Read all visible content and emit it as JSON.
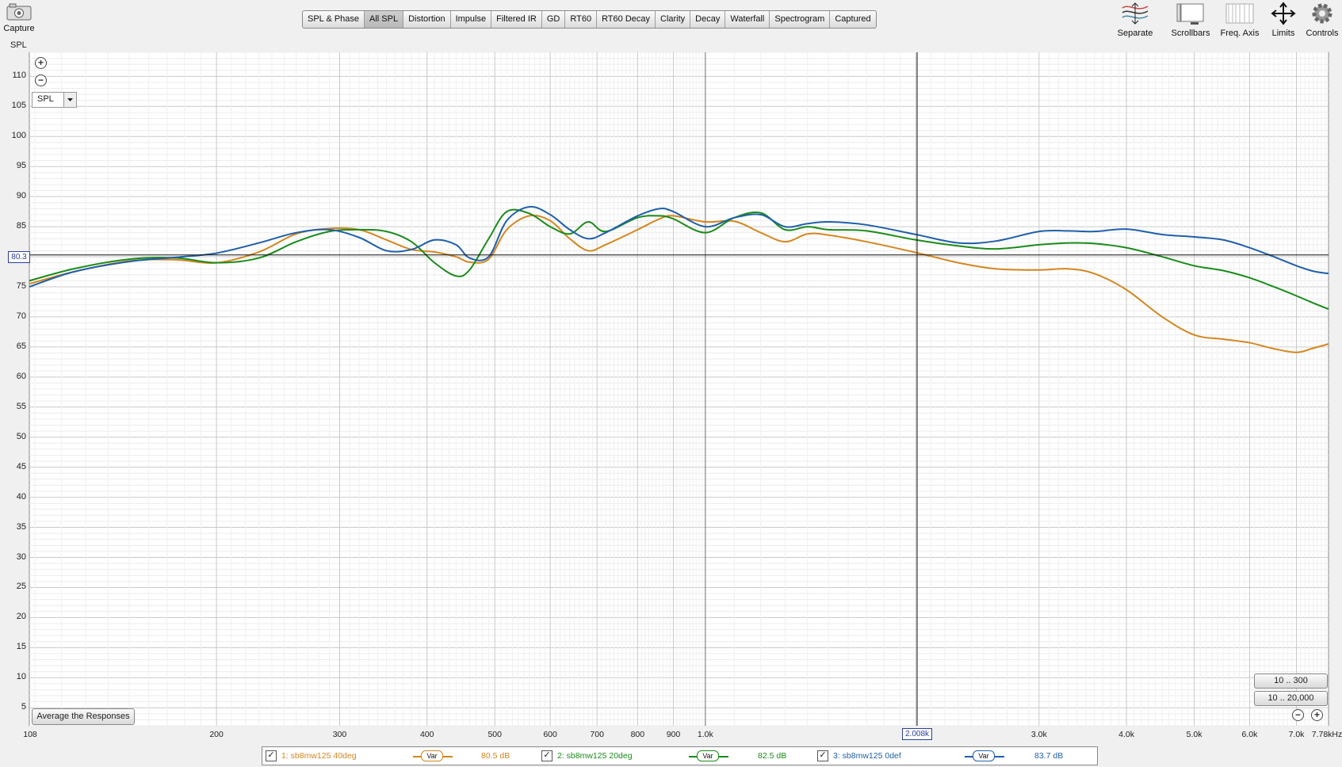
{
  "toolbar": {
    "capture_label": "Capture",
    "tabs": [
      {
        "label": "SPL & Phase",
        "active": false
      },
      {
        "label": "All SPL",
        "active": true
      },
      {
        "label": "Distortion",
        "active": false
      },
      {
        "label": "Impulse",
        "active": false
      },
      {
        "label": "Filtered IR",
        "active": false
      },
      {
        "label": "GD",
        "active": false
      },
      {
        "label": "RT60",
        "active": false
      },
      {
        "label": "RT60 Decay",
        "active": false
      },
      {
        "label": "Clarity",
        "active": false
      },
      {
        "label": "Decay",
        "active": false
      },
      {
        "label": "Waterfall",
        "active": false
      },
      {
        "label": "Spectrogram",
        "active": false
      },
      {
        "label": "Captured",
        "active": false
      }
    ],
    "right_tools": [
      "Separate",
      "Scrollbars",
      "Freq. Axis",
      "Limits",
      "Controls"
    ]
  },
  "graph": {
    "y_axis_title": "SPL",
    "mode_select": "SPL",
    "cursor_y": "80.3",
    "cursor_x": "2.008k",
    "average_button": "Average the Responses",
    "range_buttons": [
      "10 .. 300",
      "10 .. 20,000"
    ]
  },
  "chart_data": {
    "type": "line",
    "xscale": "log",
    "xlim": [
      108,
      7780
    ],
    "ylim": [
      2,
      114
    ],
    "grid": true,
    "y_ticks": [
      110,
      105,
      100,
      95,
      90,
      85,
      80,
      75,
      70,
      65,
      60,
      55,
      50,
      45,
      40,
      35,
      30,
      25,
      20,
      15,
      10,
      5
    ],
    "x_tick_labels": [
      {
        "f": 108,
        "label": "108"
      },
      {
        "f": 200,
        "label": "200"
      },
      {
        "f": 300,
        "label": "300"
      },
      {
        "f": 400,
        "label": "400"
      },
      {
        "f": 500,
        "label": "500"
      },
      {
        "f": 600,
        "label": "600"
      },
      {
        "f": 700,
        "label": "700"
      },
      {
        "f": 800,
        "label": "800"
      },
      {
        "f": 900,
        "label": "900"
      },
      {
        "f": 1000,
        "label": "1.0k"
      },
      {
        "f": 3000,
        "label": "3.0k"
      },
      {
        "f": 4000,
        "label": "4.0k"
      },
      {
        "f": 5000,
        "label": "5.0k"
      },
      {
        "f": 6000,
        "label": "6.0k"
      },
      {
        "f": 7000,
        "label": "7.0k"
      },
      {
        "f": 7780,
        "label": "7.78kHz"
      }
    ],
    "cursor": {
      "x": 2008,
      "y": 80.3
    },
    "series": [
      {
        "name": "1: sb8mw125 40deg",
        "color": "#d4861e",
        "level": "80.5 dB",
        "x": [
          108,
          125,
          150,
          175,
          200,
          230,
          260,
          290,
          320,
          350,
          380,
          410,
          440,
          460,
          490,
          520,
          560,
          600,
          640,
          680,
          720,
          800,
          860,
          900,
          1000,
          1100,
          1200,
          1300,
          1400,
          1500,
          1700,
          2000,
          2300,
          2600,
          3000,
          3300,
          3600,
          4000,
          4500,
          5000,
          5500,
          6000,
          6500,
          7000,
          7400,
          7780
        ],
        "y": [
          75.5,
          77.5,
          79.3,
          79.5,
          79.0,
          80.8,
          83.8,
          84.7,
          84.5,
          82.8,
          81.2,
          80.8,
          80.0,
          79.1,
          79.6,
          84.5,
          86.8,
          86.0,
          83.0,
          81.0,
          82.0,
          84.5,
          86.3,
          86.8,
          85.8,
          85.9,
          84.0,
          82.5,
          83.8,
          83.6,
          82.5,
          80.7,
          79.0,
          78.0,
          77.8,
          78.0,
          77.2,
          74.5,
          70.0,
          67.0,
          66.3,
          65.7,
          64.7,
          64.1,
          64.8,
          65.5
        ]
      },
      {
        "name": "2: sb8mw125 20deg",
        "color": "#1a8b1a",
        "level": "82.5 dB",
        "x": [
          108,
          125,
          150,
          175,
          200,
          230,
          260,
          290,
          320,
          350,
          380,
          410,
          440,
          460,
          490,
          520,
          560,
          600,
          640,
          680,
          720,
          800,
          860,
          900,
          1000,
          1100,
          1200,
          1300,
          1400,
          1500,
          1700,
          2000,
          2300,
          2600,
          3000,
          3300,
          3600,
          4000,
          4500,
          5000,
          5500,
          6000,
          6500,
          7000,
          7400,
          7780
        ],
        "y": [
          76.0,
          78.0,
          79.6,
          79.8,
          79.0,
          79.8,
          82.5,
          84.2,
          84.5,
          84.2,
          82.5,
          79.0,
          76.8,
          77.8,
          83.0,
          87.5,
          87.2,
          85.0,
          83.8,
          85.8,
          84.2,
          86.5,
          86.8,
          86.3,
          84.0,
          86.5,
          87.3,
          84.5,
          85.0,
          84.5,
          84.3,
          82.8,
          81.8,
          81.3,
          82.0,
          82.3,
          82.2,
          81.5,
          80.0,
          78.5,
          77.7,
          76.5,
          75.0,
          73.5,
          72.3,
          71.3
        ]
      },
      {
        "name": "3: sb8mw125 0def",
        "color": "#1f5fa8",
        "level": "83.7 dB",
        "x": [
          108,
          125,
          150,
          175,
          200,
          230,
          260,
          290,
          320,
          350,
          380,
          410,
          440,
          460,
          490,
          520,
          560,
          600,
          640,
          680,
          720,
          800,
          860,
          900,
          1000,
          1100,
          1200,
          1300,
          1400,
          1500,
          1700,
          2000,
          2300,
          2600,
          3000,
          3300,
          3600,
          4000,
          4500,
          5000,
          5500,
          6000,
          6500,
          7000,
          7400,
          7780
        ],
        "y": [
          75.0,
          77.5,
          79.2,
          79.9,
          80.6,
          82.3,
          84.0,
          84.5,
          83.2,
          81.0,
          81.2,
          82.8,
          82.0,
          79.8,
          80.0,
          86.0,
          88.3,
          87.0,
          84.5,
          83.0,
          84.0,
          86.8,
          88.0,
          87.5,
          85.0,
          86.5,
          87.0,
          85.0,
          85.5,
          85.8,
          85.3,
          83.7,
          82.3,
          82.6,
          84.2,
          84.3,
          84.2,
          84.6,
          83.7,
          83.3,
          82.8,
          81.5,
          80.0,
          78.5,
          77.6,
          77.2
        ]
      }
    ]
  }
}
